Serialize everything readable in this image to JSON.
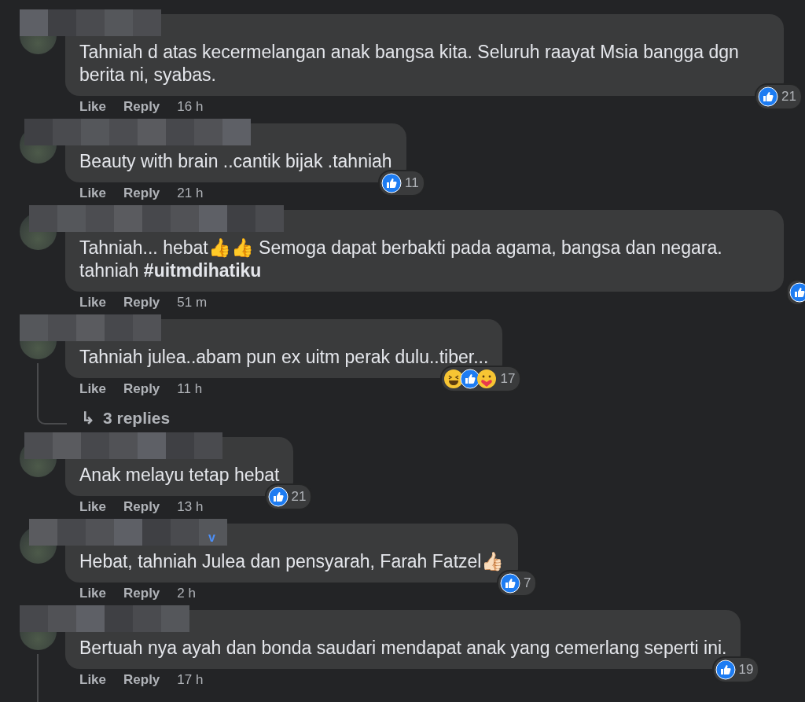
{
  "comments": [
    {
      "text": "Tahniah d atas kecermelangan anak bangsa kita. Seluruh raayat Msia bangga dgn berita ni, syabas.",
      "actions": [
        "Like",
        "Reply"
      ],
      "time": "16 h",
      "reactions": [
        {
          "kind": "like"
        }
      ],
      "reaction_count": "21",
      "thread_line": false
    },
    {
      "text": "Beauty with brain ..cantik bijak .tahniah",
      "actions": [
        "Like",
        "Reply"
      ],
      "time": "21 h",
      "reactions": [
        {
          "kind": "like"
        }
      ],
      "reaction_count": "11",
      "thread_line": false
    },
    {
      "text": "Tahniah... hebat👍👍 Semoga dapat berbakti pada agama, bangsa dan negara. tahniah **#uitmdihatiku**",
      "actions": [
        "Like",
        "Reply"
      ],
      "time": "51 m",
      "reactions": [
        {
          "kind": "like"
        }
      ],
      "thread_line": false
    },
    {
      "text": "Tahniah julea..abam pun ex uitm perak dulu..tiber...",
      "actions": [
        "Like",
        "Reply"
      ],
      "time": "11 h",
      "reactions": [
        {
          "kind": "haha"
        },
        {
          "kind": "like"
        },
        {
          "kind": "care"
        }
      ],
      "reaction_count": "17",
      "thread_line": true,
      "replies_link": "3 replies",
      "replies_arrow": "↳"
    },
    {
      "text": "Anak melayu tetap hebat",
      "actions": [
        "Like",
        "Reply"
      ],
      "time": "13 h",
      "reactions": [
        {
          "kind": "like"
        }
      ],
      "reaction_count": "21",
      "thread_line": false
    },
    {
      "name_visible": "v",
      "text": "Hebat, tahniah Julea dan pensyarah, Farah Fatzel👍🏻",
      "actions": [
        "Like",
        "Reply"
      ],
      "time": "2 h",
      "reactions": [
        {
          "kind": "like"
        }
      ],
      "reaction_count": "7",
      "thread_line": false
    },
    {
      "text": "Bertuah nya ayah dan bonda saudari mendapat anak yang cemerlang seperti ini.",
      "actions": [
        "Like",
        "Reply"
      ],
      "time": "17 h",
      "reactions": [
        {
          "kind": "like"
        }
      ],
      "reaction_count": "19",
      "thread_line": true
    }
  ]
}
